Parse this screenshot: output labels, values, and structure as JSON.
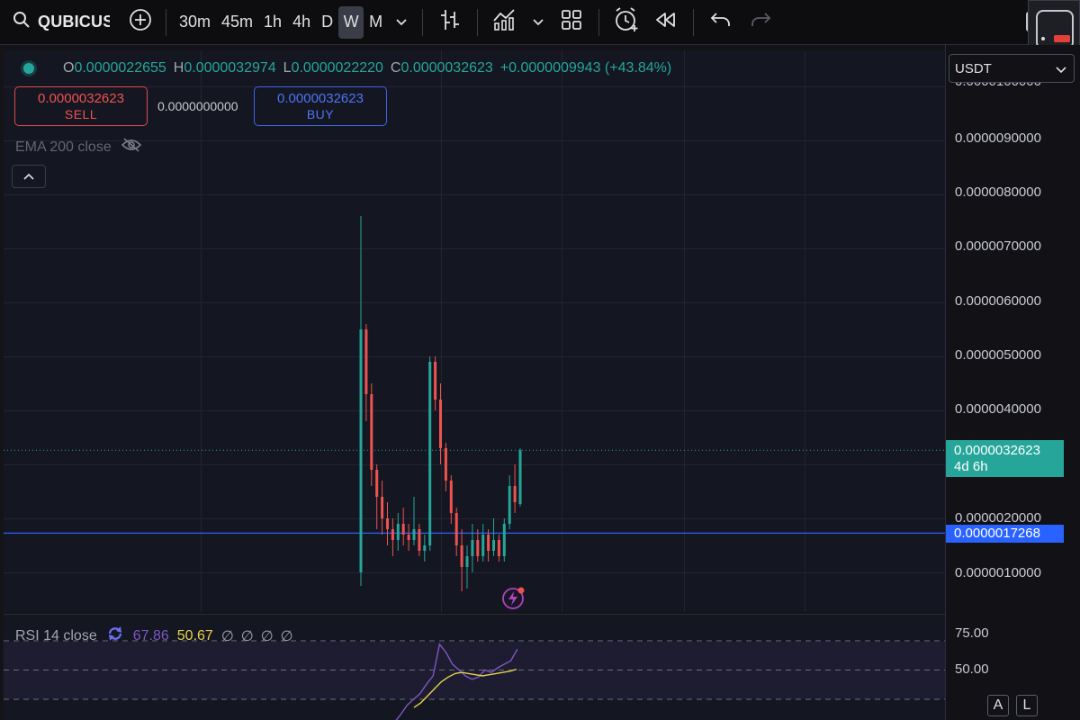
{
  "toolbar": {
    "symbol": "QUBICUS",
    "timeframes": [
      "30m",
      "45m",
      "1h",
      "4h",
      "D",
      "W",
      "M"
    ],
    "active_timeframe": "W",
    "icons": [
      "search-icon",
      "add-symbol-icon",
      "chevron-down-icon",
      "bar-style-icon",
      "indicators-icon",
      "chevron-down-icon",
      "layout-icon",
      "alert-icon",
      "replay-icon",
      "undo-icon",
      "redo-icon"
    ]
  },
  "legend": {
    "o_key": "O",
    "o_val": "0.0000022655",
    "h_key": "H",
    "h_val": "0.0000032974",
    "l_key": "L",
    "l_val": "0.0000022220",
    "c_key": "C",
    "c_val": "0.0000032623",
    "change": "+0.0000009943 (+43.84%)"
  },
  "trade": {
    "sell_price": "0.0000032623",
    "sell_label": "SELL",
    "spread": "0.0000000000",
    "buy_price": "0.0000032623",
    "buy_label": "BUY"
  },
  "indicators": {
    "ema_label": "EMA 200 close",
    "rsi_label": "RSI 14 close",
    "rsi_value": "67.86",
    "rsi_ma_value": "50.67",
    "rsi_na": [
      "∅",
      "∅",
      "∅",
      "∅"
    ]
  },
  "price_axis": {
    "currency": "USDT",
    "labels": [
      "0.0000090000",
      "0.0000080000",
      "0.0000070000",
      "0.0000060000",
      "0.0000050000",
      "0.0000040000",
      "0.0000020000",
      "0.0000010000"
    ],
    "current_price": "0.0000032623",
    "countdown": "4d 6h",
    "line_price": "0.0000017268",
    "rsi_labels": [
      "75.00",
      "50.00"
    ],
    "buttons": [
      "A",
      "L"
    ]
  },
  "colors": {
    "up": "#26a69a",
    "down": "#ef5350",
    "blue_line": "#2962ff",
    "rsi": "#7e57c2",
    "rsi_ma": "#e6d24f"
  },
  "chart_data": {
    "type": "candlestick",
    "unit": "USDT",
    "current_price": 3.2623e-06,
    "horizontal_line": 1.7268e-06,
    "candles": [
      {
        "o": 1e-06,
        "h": 7.6e-06,
        "l": 7.5e-07,
        "c": 5.5e-06
      },
      {
        "o": 5.5e-06,
        "h": 5.6e-06,
        "l": 3.8e-06,
        "c": 4.3e-06
      },
      {
        "o": 4.3e-06,
        "h": 4.5e-06,
        "l": 2.6e-06,
        "c": 2.9e-06
      },
      {
        "o": 2.9e-06,
        "h": 3e-06,
        "l": 1.8e-06,
        "c": 2.4e-06
      },
      {
        "o": 2.4e-06,
        "h": 2.7e-06,
        "l": 1.7e-06,
        "c": 2e-06
      },
      {
        "o": 2e-06,
        "h": 2.3e-06,
        "l": 1.5e-06,
        "c": 1.8e-06
      },
      {
        "o": 1.8e-06,
        "h": 2e-06,
        "l": 1.3e-06,
        "c": 1.6e-06
      },
      {
        "o": 1.6e-06,
        "h": 2.1e-06,
        "l": 1.4e-06,
        "c": 1.9e-06
      },
      {
        "o": 1.9e-06,
        "h": 2.2e-06,
        "l": 1.5e-06,
        "c": 1.7e-06
      },
      {
        "o": 1.7e-06,
        "h": 1.9e-06,
        "l": 1.4e-06,
        "c": 1.6e-06
      },
      {
        "o": 1.6e-06,
        "h": 2.4e-06,
        "l": 1.5e-06,
        "c": 1.8e-06
      },
      {
        "o": 1.8e-06,
        "h": 1.9e-06,
        "l": 1.3e-06,
        "c": 1.4e-06
      },
      {
        "o": 1.4e-06,
        "h": 1.7e-06,
        "l": 1.2e-06,
        "c": 1.5e-06
      },
      {
        "o": 1.5e-06,
        "h": 5e-06,
        "l": 1.4e-06,
        "c": 4.9e-06
      },
      {
        "o": 4.9e-06,
        "h": 5e-06,
        "l": 4e-06,
        "c": 4.2e-06
      },
      {
        "o": 4.2e-06,
        "h": 4.5e-06,
        "l": 3e-06,
        "c": 3.3e-06
      },
      {
        "o": 3.3e-06,
        "h": 3.4e-06,
        "l": 2.5e-06,
        "c": 2.7e-06
      },
      {
        "o": 2.7e-06,
        "h": 2.8e-06,
        "l": 1.9e-06,
        "c": 2.1e-06
      },
      {
        "o": 2.1e-06,
        "h": 2.2e-06,
        "l": 1.3e-06,
        "c": 1.5e-06
      },
      {
        "o": 1.5e-06,
        "h": 1.8e-06,
        "l": 6.5e-07,
        "c": 1.1e-06
      },
      {
        "o": 1.1e-06,
        "h": 1.5e-06,
        "l": 7e-07,
        "c": 1.3e-06
      },
      {
        "o": 1.3e-06,
        "h": 1.9e-06,
        "l": 1e-06,
        "c": 1.6e-06
      },
      {
        "o": 1.6e-06,
        "h": 1.8e-06,
        "l": 1.2e-06,
        "c": 1.3e-06
      },
      {
        "o": 1.3e-06,
        "h": 1.9e-06,
        "l": 1.2e-06,
        "c": 1.7e-06
      },
      {
        "o": 1.7e-06,
        "h": 1.8e-06,
        "l": 1.2e-06,
        "c": 1.4e-06
      },
      {
        "o": 1.4e-06,
        "h": 2e-06,
        "l": 1.3e-06,
        "c": 1.6e-06
      },
      {
        "o": 1.6e-06,
        "h": 1.7e-06,
        "l": 1.2e-06,
        "c": 1.3e-06
      },
      {
        "o": 1.3e-06,
        "h": 2e-06,
        "l": 1.2e-06,
        "c": 1.9e-06
      },
      {
        "o": 1.9e-06,
        "h": 2.8e-06,
        "l": 1.8e-06,
        "c": 2.6e-06
      },
      {
        "o": 2.6e-06,
        "h": 3e-06,
        "l": 2.1e-06,
        "c": 2.3e-06
      },
      {
        "o": 2.2655e-06,
        "h": 3.2974e-06,
        "l": 2.222e-06,
        "c": 3.2623e-06
      }
    ],
    "rsi": [
      5,
      12,
      20,
      25,
      30,
      38,
      45,
      72,
      65,
      55,
      50,
      45,
      42,
      44,
      50,
      48,
      52,
      55,
      58,
      67.86
    ],
    "rsi_ma": [
      18,
      22,
      28,
      34,
      40,
      44,
      47,
      48,
      47,
      46,
      45,
      46,
      47,
      48,
      49,
      50.67
    ]
  }
}
